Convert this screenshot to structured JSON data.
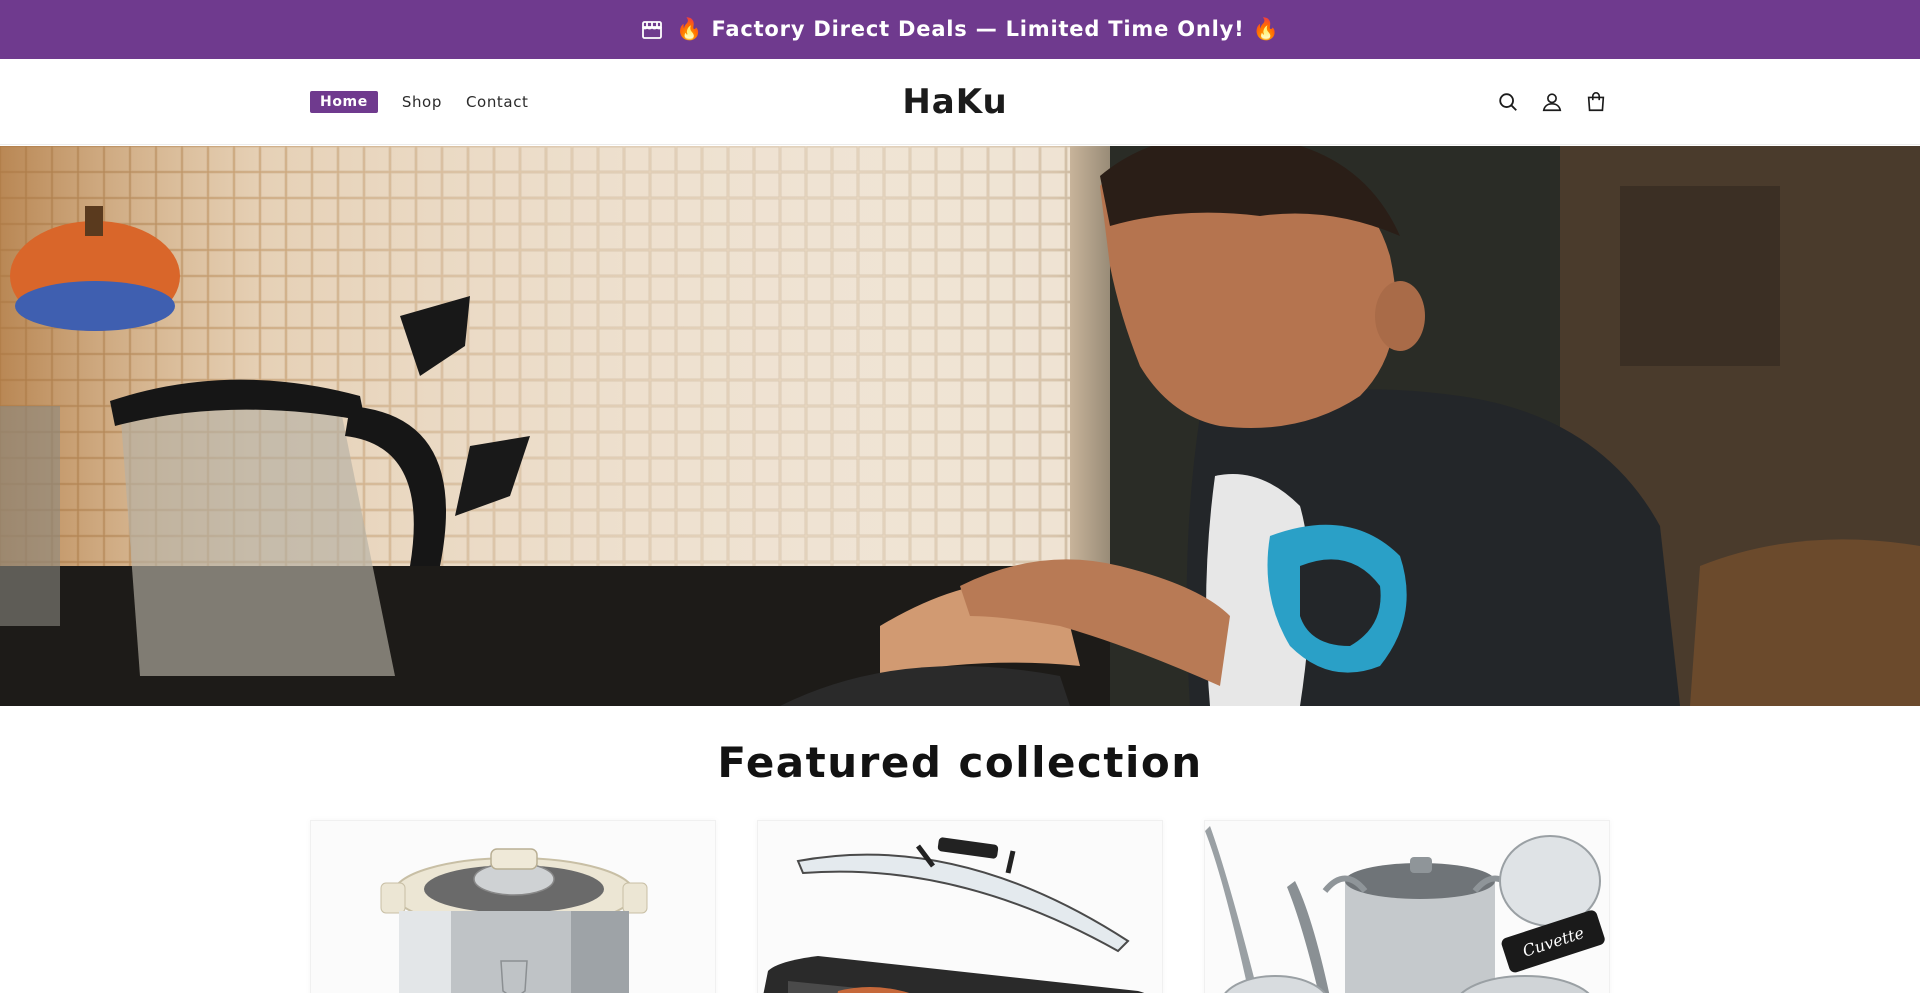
{
  "announcement": {
    "icon": "store-icon",
    "text": "🔥 Factory Direct Deals — Limited Time Only! 🔥",
    "background": "#6f3a8e"
  },
  "header": {
    "logo": "HaKu",
    "nav": [
      {
        "label": "Home",
        "active": true
      },
      {
        "label": "Shop",
        "active": false
      },
      {
        "label": "Contact",
        "active": false
      }
    ],
    "icons": [
      "search-icon",
      "account-icon",
      "cart-icon"
    ]
  },
  "hero": {
    "image": "hero-image-kitchen"
  },
  "featured": {
    "title": "Featured collection",
    "products": [
      {
        "image": "pressure-cooker-image"
      },
      {
        "image": "grill-pan-with-lid-image"
      },
      {
        "image": "cookware-set-image",
        "tag_text": "Cuvette"
      }
    ]
  }
}
